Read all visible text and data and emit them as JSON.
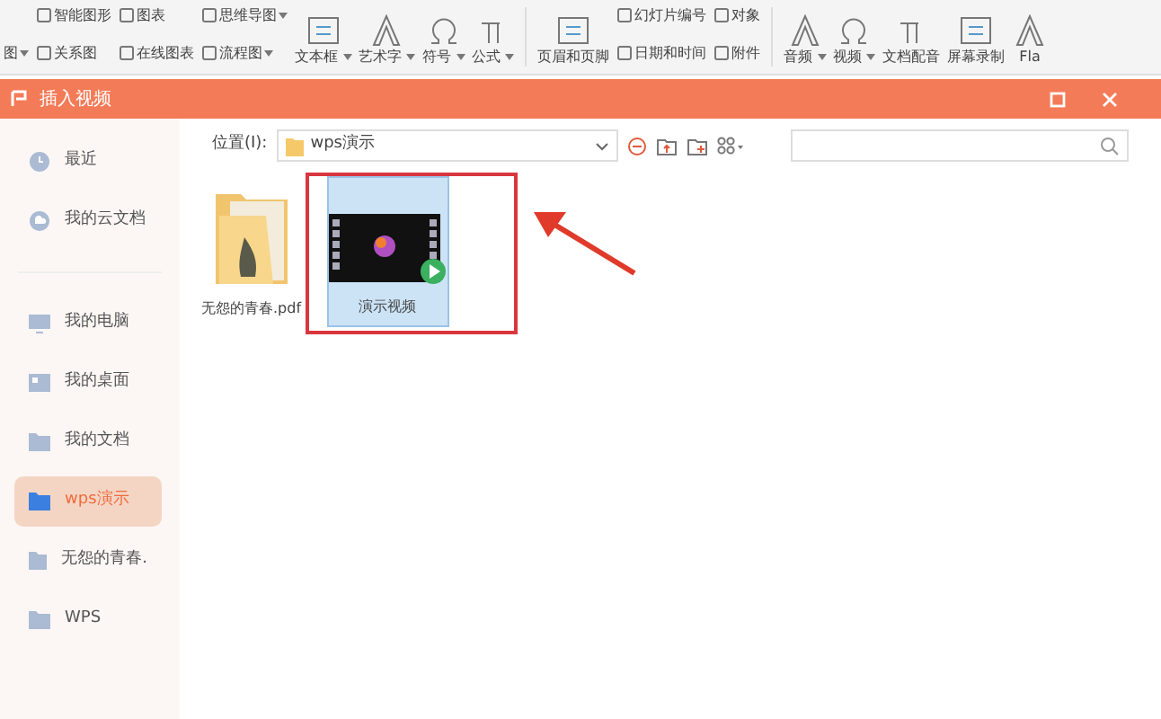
{
  "ribbon": [
    {
      "kind": "small",
      "items": [
        {
          "label": "图",
          "caret": true
        }
      ]
    },
    {
      "kind": "small",
      "items": [
        {
          "label": "智能图形",
          "caret": false
        },
        {
          "label": "关系图",
          "caret": false
        }
      ]
    },
    {
      "kind": "small",
      "items": [
        {
          "label": "图表",
          "caret": false
        },
        {
          "label": "在线图表",
          "caret": false
        }
      ]
    },
    {
      "kind": "small",
      "items": [
        {
          "label": "思维导图",
          "caret": true
        },
        {
          "label": "流程图",
          "caret": true
        }
      ]
    },
    {
      "kind": "large",
      "label": "文本框",
      "caret": true
    },
    {
      "kind": "large",
      "label": "艺术字",
      "caret": true
    },
    {
      "kind": "large",
      "label": "符号",
      "caret": true
    },
    {
      "kind": "large",
      "label": "公式",
      "caret": true
    },
    {
      "kind": "sep"
    },
    {
      "kind": "large",
      "label": "页眉和页脚",
      "caret": false
    },
    {
      "kind": "small",
      "items": [
        {
          "label": "幻灯片编号",
          "caret": false
        },
        {
          "label": "日期和时间",
          "caret": false
        }
      ]
    },
    {
      "kind": "small",
      "items": [
        {
          "label": "对象",
          "caret": false
        },
        {
          "label": "附件",
          "caret": false
        }
      ]
    },
    {
      "kind": "sep"
    },
    {
      "kind": "large",
      "label": "音频",
      "caret": true
    },
    {
      "kind": "large",
      "label": "视频",
      "caret": true
    },
    {
      "kind": "large",
      "label": "文档配音",
      "caret": false
    },
    {
      "kind": "large",
      "label": "屏幕录制",
      "caret": false
    },
    {
      "kind": "large",
      "label": "Fla",
      "caret": false
    }
  ],
  "dialog": {
    "title": "插入视频",
    "sidebar_groups": [
      [
        {
          "label": "最近",
          "selected": false
        },
        {
          "label": "我的云文档",
          "selected": false
        }
      ],
      [
        {
          "label": "我的电脑",
          "selected": false
        },
        {
          "label": "我的桌面",
          "selected": false
        },
        {
          "label": "我的文档",
          "selected": false
        },
        {
          "label": "wps演示",
          "selected": true
        },
        {
          "label": "无怨的青春.",
          "selected": false
        },
        {
          "label": "WPS",
          "selected": false
        }
      ]
    ],
    "location_label": "位置(I):",
    "location": "wps演示",
    "files": [
      {
        "name": "无怨的青春.pdf",
        "kind": "folder",
        "selected": false
      },
      {
        "name": "演示视频",
        "kind": "video",
        "selected": true
      }
    ]
  }
}
